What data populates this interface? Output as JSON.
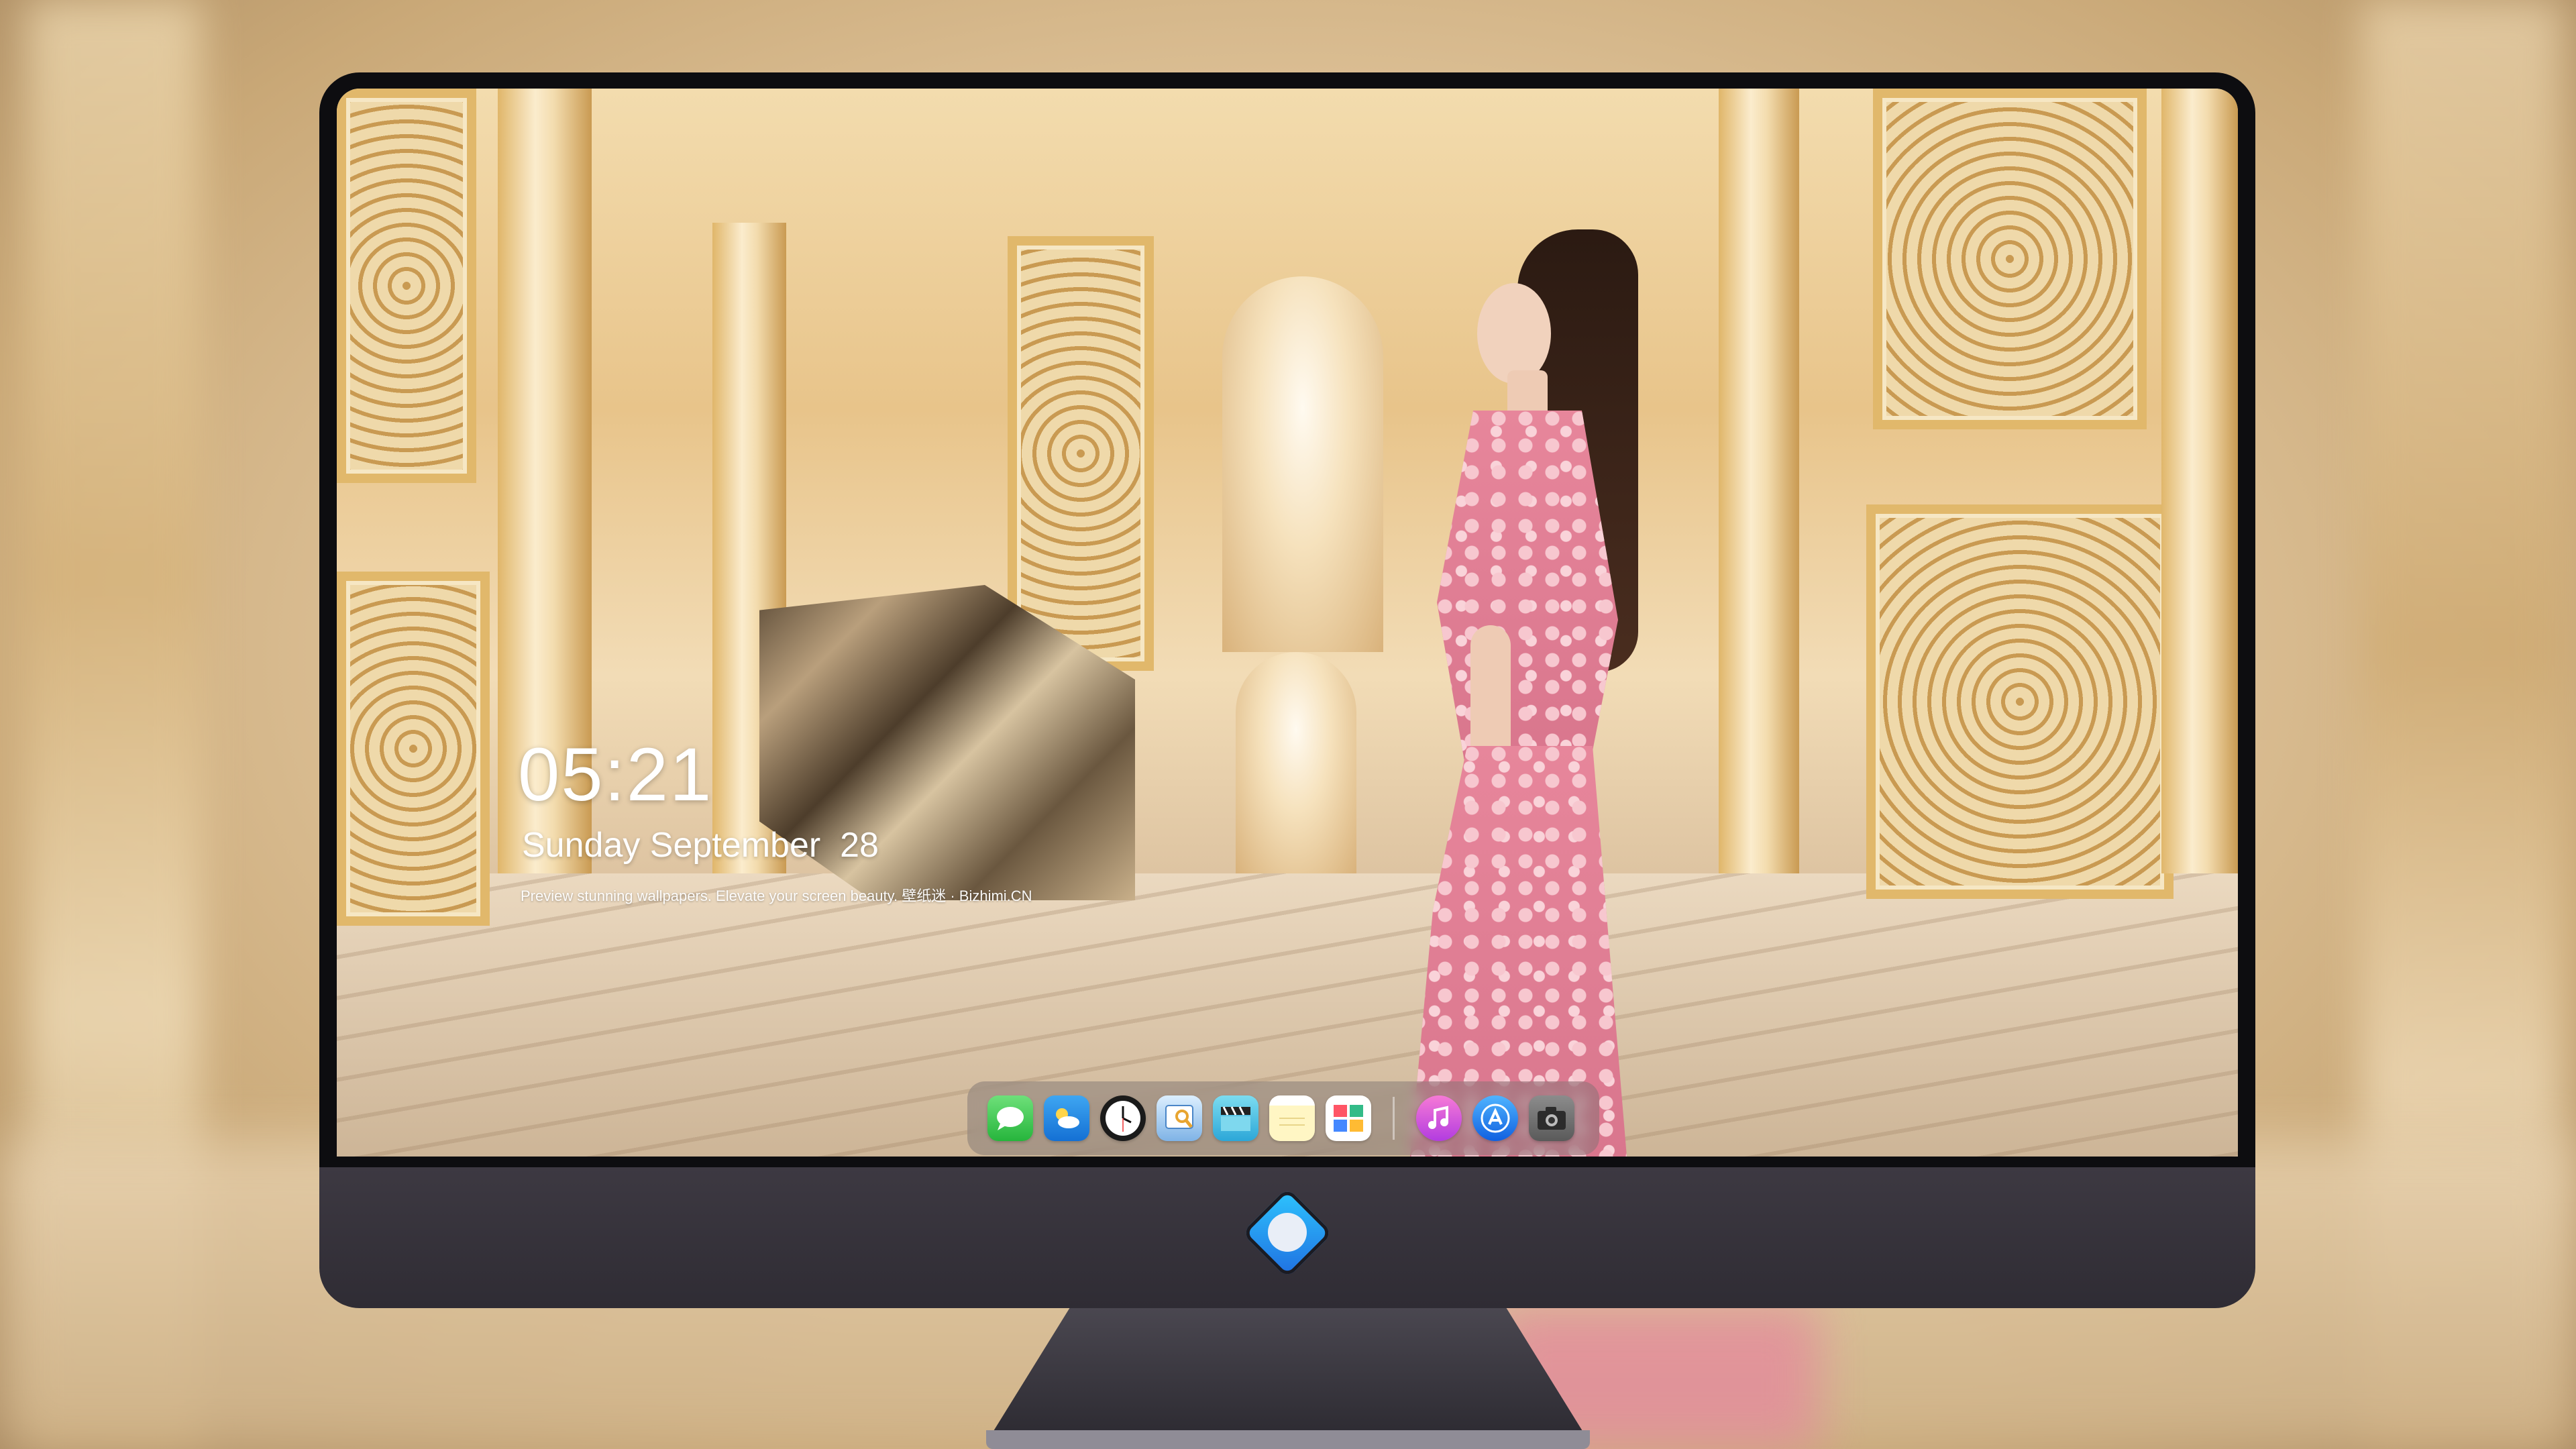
{
  "lockscreen": {
    "time": "05:21",
    "date": "Sunday September  28",
    "tagline": "Preview stunning wallpapers. Elevate your screen beauty. 壁纸迷 · Bizhimi.CN"
  },
  "dock": {
    "apps": [
      "messages-icon",
      "weather-icon",
      "clock-icon",
      "preview-icon",
      "clips-icon",
      "notes-icon",
      "photos-icon",
      "music-icon",
      "app-store-icon",
      "camera-icon"
    ]
  },
  "colors": {
    "dress": "#e7869b",
    "gold": "#e1b86b",
    "bezel": "#0d0d10",
    "chin": "#36333b"
  }
}
